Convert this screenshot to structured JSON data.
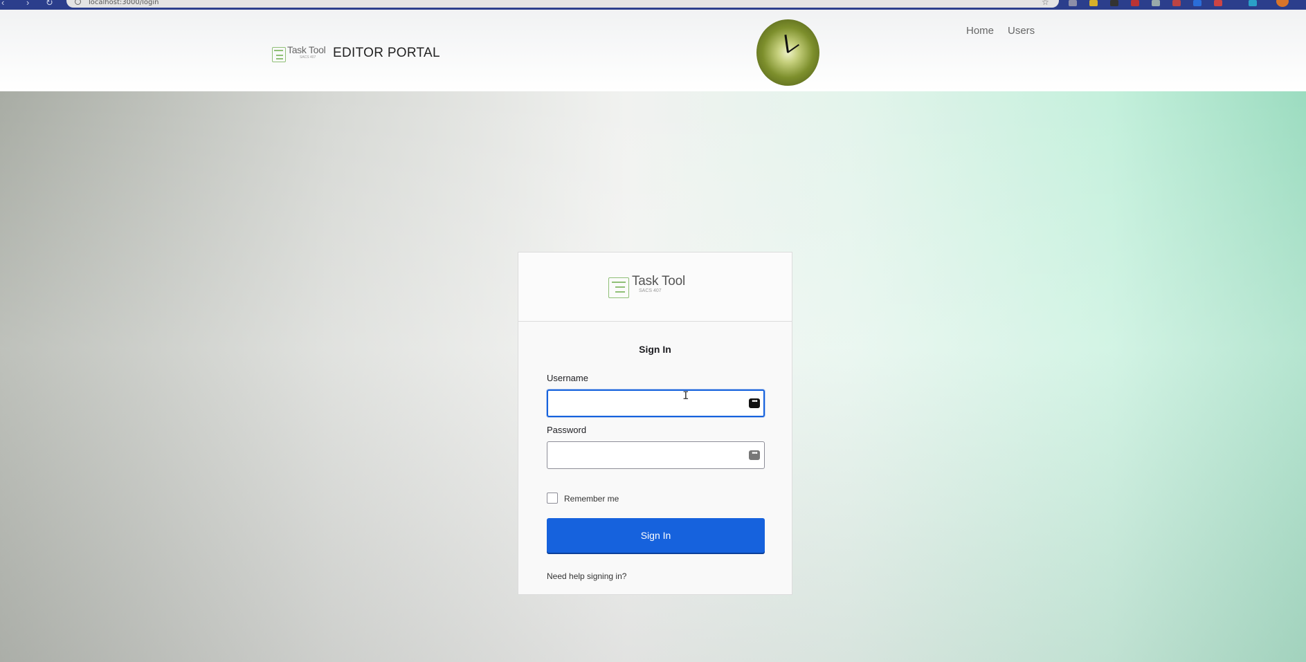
{
  "browser": {
    "url": "localhost:3000/login"
  },
  "header": {
    "logo_text": "Task Tool",
    "logo_subtext": "SACS 407",
    "portal_title": "EDITOR PORTAL",
    "nav": [
      {
        "label": "Home"
      },
      {
        "label": "Users"
      }
    ]
  },
  "login": {
    "logo_text": "Task Tool",
    "logo_subtext": "SACS 407",
    "title": "Sign In",
    "username": {
      "label": "Username",
      "value": ""
    },
    "password": {
      "label": "Password",
      "value": ""
    },
    "remember_label": "Remember me",
    "remember_checked": false,
    "submit_label": "Sign In",
    "help_link": "Need help signing in?"
  },
  "colors": {
    "primary_button": "#1662dd",
    "logo_green": "#8fbf76",
    "browser_bar": "#2b3e8c"
  }
}
